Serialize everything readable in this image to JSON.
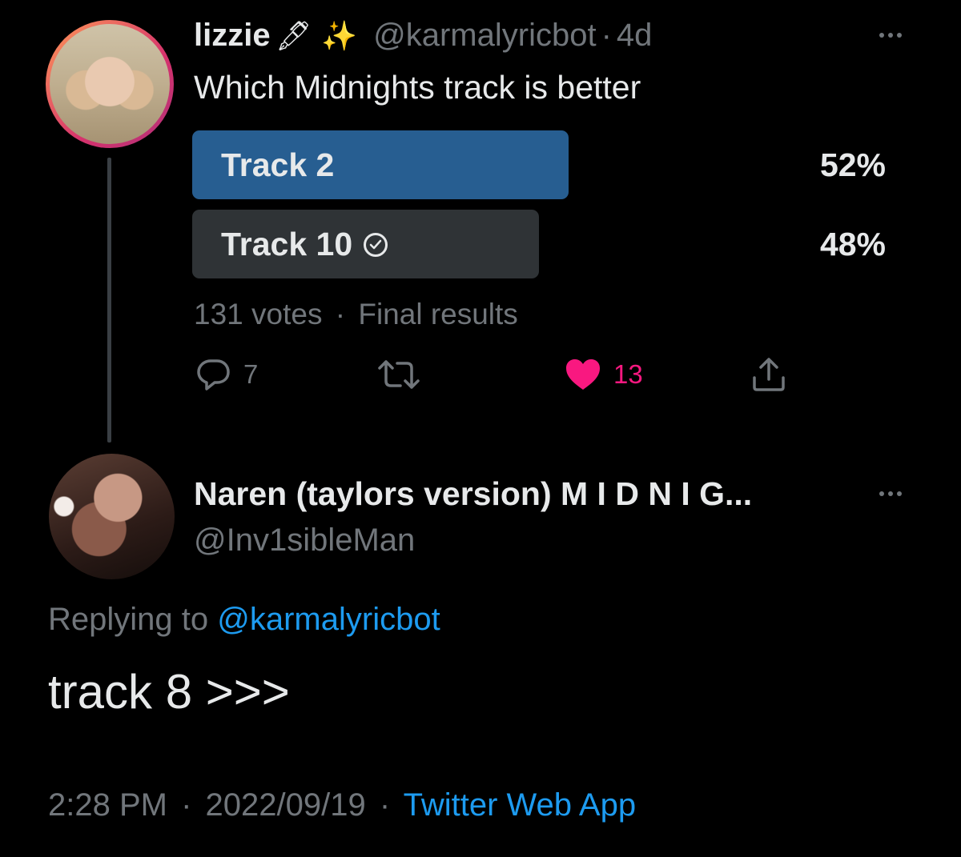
{
  "tweet1": {
    "display_name": "lizzie",
    "name_emojis": [
      "🖋",
      "✨"
    ],
    "handle": "@karmalyricbot",
    "separator": "·",
    "age": "4d",
    "text": "Which Midnights track is better",
    "poll": {
      "options": [
        {
          "label": "Track 2",
          "percent": "52%",
          "value": 52
        },
        {
          "label": "Track 10",
          "percent": "48%",
          "value": 48,
          "selected": true
        }
      ],
      "votes": "131 votes",
      "separator": "·",
      "status": "Final results"
    },
    "actions": {
      "reply_count": "7",
      "retweet_count": "",
      "like_count": "13",
      "liked": true
    }
  },
  "tweet2": {
    "display_name": "Naren (taylors version) M I D N I G...",
    "handle": "@Inv1sibleMan",
    "replying_prefix": "Replying to",
    "replying_to": "@karmalyricbot",
    "text": "track 8 >>>",
    "time": "2:28 PM",
    "separator": "·",
    "date": "2022/09/19",
    "separator2": "·",
    "source": "Twitter Web App"
  },
  "colors": {
    "background": "#000000",
    "primary_text": "#e7e9ea",
    "secondary_text": "#71767b",
    "link": "#1d9bf0",
    "poll_winner": "#275e91",
    "poll_other": "#2f3336",
    "like": "#f91880"
  }
}
